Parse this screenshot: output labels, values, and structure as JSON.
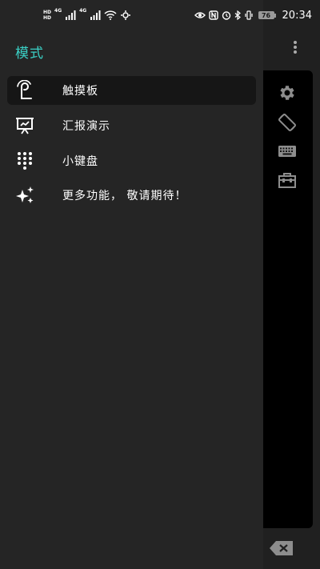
{
  "status_bar": {
    "sim1": "HD",
    "sim2": "HD",
    "net1": "4G",
    "net2": "4G",
    "battery": "76",
    "time": "20:34",
    "icons": [
      "eye-icon",
      "nfc-icon",
      "alarm-icon",
      "bluetooth-icon"
    ]
  },
  "drawer": {
    "title": "模式",
    "title_color": "#3ad0c5",
    "items": [
      {
        "label": "触摸板",
        "icon": "touchpad-icon",
        "selected": true
      },
      {
        "label": "汇报演示",
        "icon": "presentation-icon",
        "selected": false
      },
      {
        "label": "小键盘",
        "icon": "keypad-icon",
        "selected": false
      },
      {
        "label": "更多功能， 敬请期待！",
        "icon": "sparkle-icon",
        "selected": false
      }
    ]
  },
  "app_toolbar": {
    "icons": [
      "settings-icon",
      "rotate-screen-icon",
      "keyboard-icon",
      "toolbox-icon",
      "overflow-menu-icon",
      "backspace-icon"
    ]
  }
}
